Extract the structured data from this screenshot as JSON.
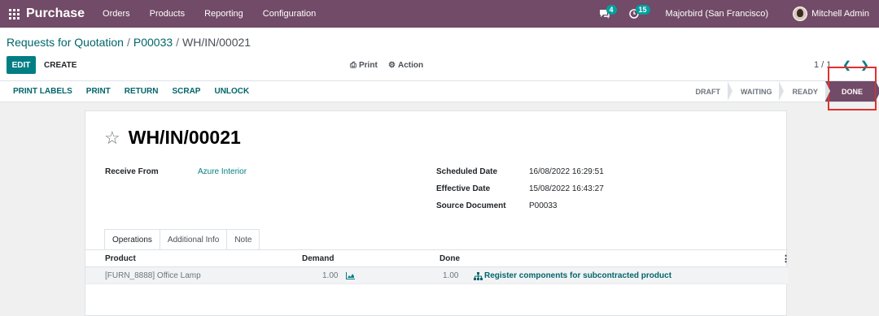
{
  "navbar": {
    "app_name": "Purchase",
    "menu": [
      "Orders",
      "Products",
      "Reporting",
      "Configuration"
    ],
    "messages_count": "4",
    "activities_count": "15",
    "company": "Majorbird (San Francisco)",
    "user": "Mitchell Admin",
    "bg_color": "#714B67"
  },
  "breadcrumb": {
    "items": [
      "Requests for Quotation",
      "P00033"
    ],
    "current": "WH/IN/00021",
    "separator": "/"
  },
  "toolbar": {
    "edit": "EDIT",
    "create": "CREATE",
    "print": "Print",
    "action": "Action",
    "pager": "1 / 1"
  },
  "statusbar": {
    "buttons": [
      "PRINT LABELS",
      "PRINT",
      "RETURN",
      "SCRAP",
      "UNLOCK"
    ],
    "stages": [
      "DRAFT",
      "WAITING",
      "READY",
      "DONE"
    ],
    "active_stage": "DONE"
  },
  "form": {
    "title": "WH/IN/00021",
    "receive_from_label": "Receive From",
    "receive_from_value": "Azure Interior",
    "scheduled_date_label": "Scheduled Date",
    "scheduled_date_value": "16/08/2022 16:29:51",
    "effective_date_label": "Effective Date",
    "effective_date_value": "15/08/2022 16:43:27",
    "source_document_label": "Source Document",
    "source_document_value": "P00033"
  },
  "tabs": [
    "Operations",
    "Additional Info",
    "Note"
  ],
  "table": {
    "columns": [
      "Product",
      "Demand",
      "Done"
    ],
    "rows": [
      {
        "product": "[FURN_8888] Office Lamp",
        "demand": "1.00",
        "done": "1.00",
        "action": "Register components for subcontracted product"
      }
    ]
  }
}
